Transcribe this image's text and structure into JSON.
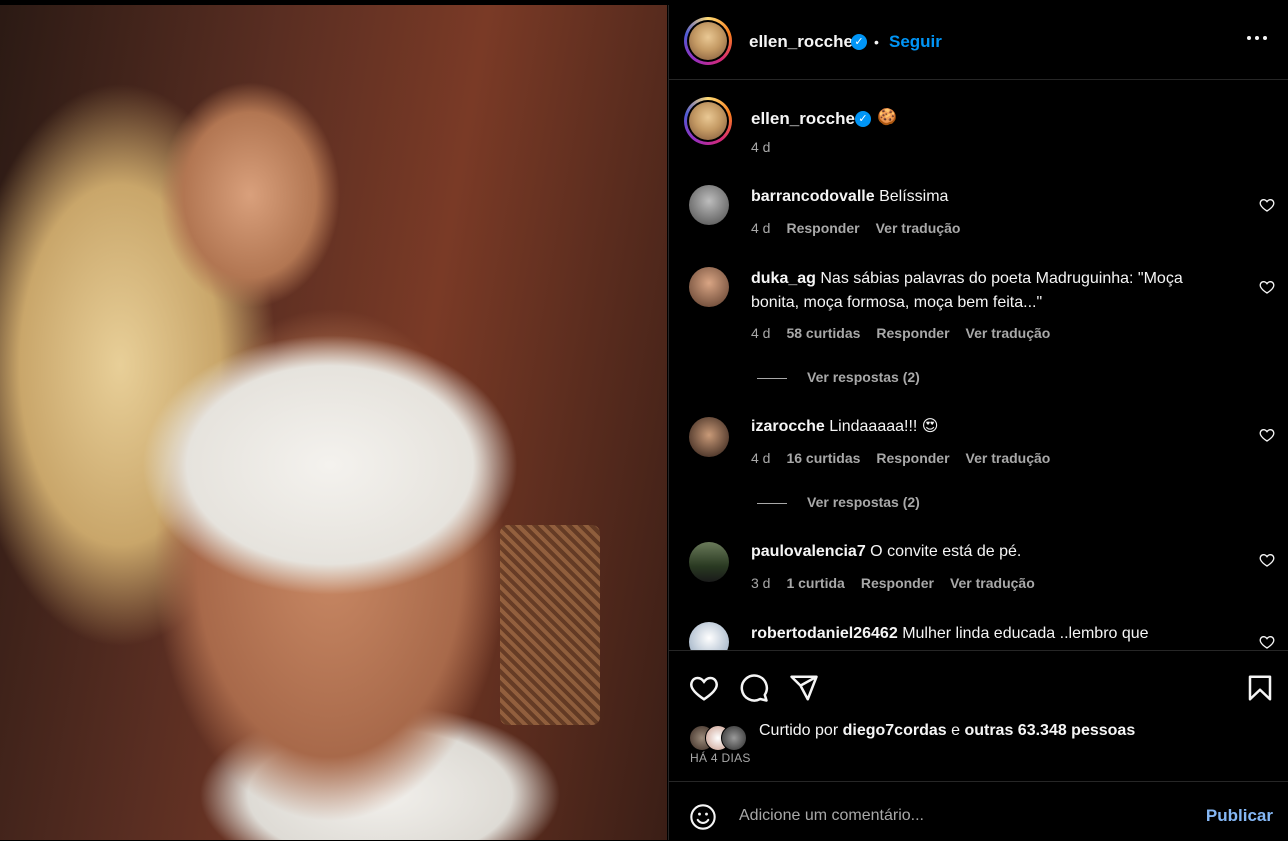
{
  "header": {
    "username": "ellen_rocche",
    "separator": "•",
    "follow_label": "Seguir",
    "more_label": "•••"
  },
  "caption": {
    "username": "ellen_rocche",
    "emoji": "🍪",
    "time": "4 d"
  },
  "comments": [
    {
      "username": "barrancodovalle",
      "text": "Belíssima",
      "time": "4 d",
      "likes": "",
      "reply": "Responder",
      "translate": "Ver tradução"
    },
    {
      "username": "duka_ag",
      "text": "Nas sábias palavras do poeta Madruguinha: \"Moça bonita, moça formosa, moça bem feita...\"",
      "time": "4 d",
      "likes": "58 curtidas",
      "reply": "Responder",
      "translate": "Ver tradução",
      "view_replies": "Ver respostas (2)"
    },
    {
      "username": "izarocche",
      "text": "Lindaaaaa!!! 😍",
      "time": "4 d",
      "likes": "16 curtidas",
      "reply": "Responder",
      "translate": "Ver tradução",
      "view_replies": "Ver respostas (2)"
    },
    {
      "username": "paulovalencia7",
      "text": "O convite está de pé.",
      "time": "3 d",
      "likes": "1 curtida",
      "reply": "Responder",
      "translate": "Ver tradução"
    },
    {
      "username": "robertodaniel26462",
      "text": "Mulher linda educada ..lembro que"
    }
  ],
  "likes": {
    "prefix": "Curtido por",
    "user": "diego7cordas",
    "conj": "e",
    "others": "outras 63.348 pessoas"
  },
  "post_date": "HÁ 4 DIAS",
  "add_comment": {
    "placeholder": "Adicione um comentário...",
    "publish_label": "Publicar"
  },
  "colors": {
    "accent": "#0095f6",
    "publish": "#85b7f4",
    "muted": "#a8a8a8",
    "divider": "#262626"
  }
}
